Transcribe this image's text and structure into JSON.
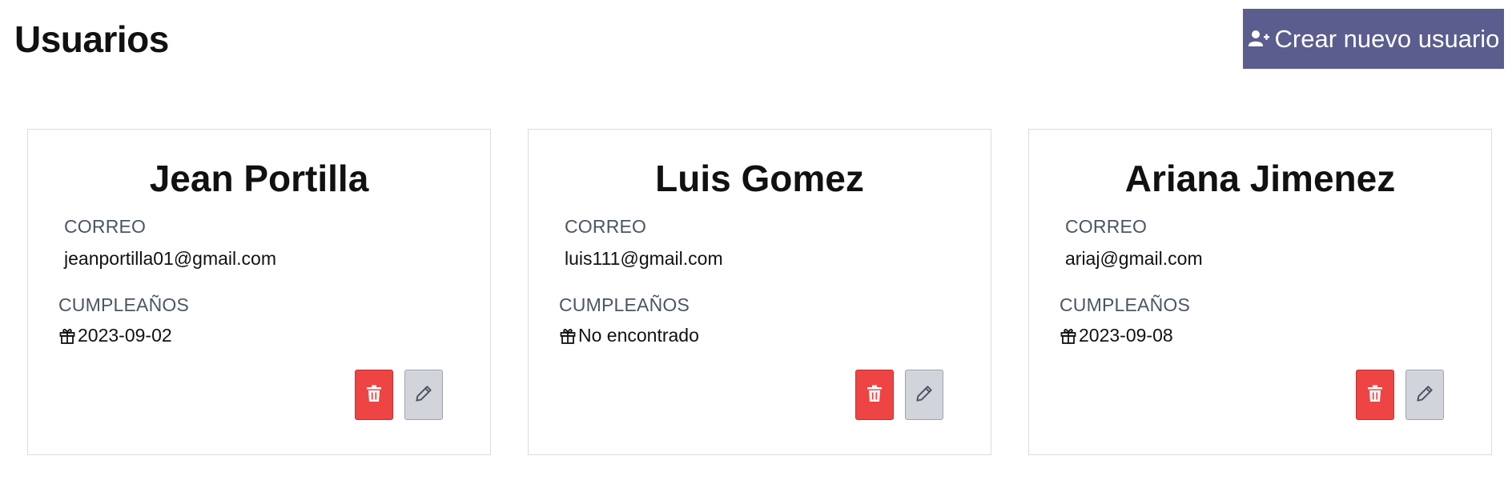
{
  "header": {
    "title": "Usuarios",
    "create_button_label": "Crear nuevo usuario",
    "create_button_icon": "user-plus-icon"
  },
  "labels": {
    "email": "CORREO",
    "birthday": "CUMPLEAÑOS"
  },
  "users": [
    {
      "name": "Jean Portilla",
      "email": "jeanportilla01@gmail.com",
      "birthday": "2023-09-02"
    },
    {
      "name": "Luis Gomez",
      "email": "luis111@gmail.com",
      "birthday": "No encontrado"
    },
    {
      "name": "Ariana Jimenez",
      "email": "ariaj@gmail.com",
      "birthday": "2023-09-08"
    }
  ],
  "card_icons": {
    "birthday": "gift-icon",
    "delete": "trash-icon",
    "edit": "pencil-icon"
  },
  "colors": {
    "primary_button": "#5a5d8e",
    "delete_button": "#ef4444",
    "edit_button": "#d1d5db"
  }
}
